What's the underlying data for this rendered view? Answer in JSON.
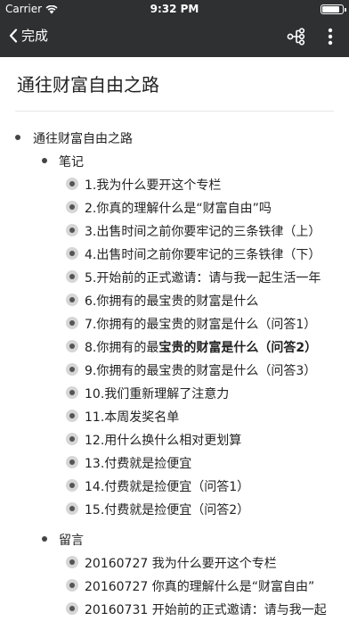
{
  "status_bar": {
    "carrier": "Carrier",
    "time": "9:32 PM",
    "battery_level": 0.9
  },
  "nav": {
    "back_label": "完成",
    "tree_icon": "mindmap-icon",
    "more_icon": "more-vertical-icon"
  },
  "doc": {
    "title": "通往财富自由之路"
  },
  "tree": {
    "root": {
      "label": "通往财富自由之路"
    },
    "notes_section": {
      "label": "笔记",
      "items": [
        {
          "pre": "1.我为什么要开这个专栏",
          "bold": "",
          "post": ""
        },
        {
          "pre": "2.你真的理解什么是“财富自由”吗",
          "bold": "",
          "post": ""
        },
        {
          "pre": "3.出售时间之前你要牢记的三条铁律（上）",
          "bold": "",
          "post": ""
        },
        {
          "pre": "4.出售时间之前你要牢记的三条铁律（下）",
          "bold": "",
          "post": ""
        },
        {
          "pre": "5.开始前的正式邀请：请与我一起生活一年",
          "bold": "",
          "post": ""
        },
        {
          "pre": "6.你拥有的最宝贵的财富是什么",
          "bold": "",
          "post": ""
        },
        {
          "pre": "7.你拥有的最宝贵的财富是什么（问答1）",
          "bold": "",
          "post": ""
        },
        {
          "pre": "8.你拥有的最",
          "bold": "宝贵的财富是什么（问答2）",
          "post": ""
        },
        {
          "pre": "9.你拥有的最宝贵的财富是什么（问答3）",
          "bold": "",
          "post": ""
        },
        {
          "pre": "10.我们重新理解了注意力",
          "bold": "",
          "post": ""
        },
        {
          "pre": "11.本周发奖名单",
          "bold": "",
          "post": ""
        },
        {
          "pre": "12.用什么换什么相对更划算",
          "bold": "",
          "post": ""
        },
        {
          "pre": "13.付费就是捡便宜",
          "bold": "",
          "post": ""
        },
        {
          "pre": "14.付费就是捡便宜（问答1）",
          "bold": "",
          "post": ""
        },
        {
          "pre": "15.付费就是捡便宜（问答2）",
          "bold": "",
          "post": ""
        }
      ]
    },
    "comments_section": {
      "label": "留言",
      "items": [
        {
          "pre": "20160727 我为什么要开这个专栏",
          "bold": "",
          "post": ""
        },
        {
          "pre": "20160727 你真的理解什么是“财富自由”",
          "bold": "",
          "post": ""
        },
        {
          "pre": "20160731 开始前的正式邀请：请与我一起",
          "bold": "",
          "post": ""
        }
      ]
    }
  },
  "colors": {
    "navbar_bg": "#2f3032",
    "bullet_outer": "#d6d6d6",
    "bullet_inner": "#555555"
  }
}
